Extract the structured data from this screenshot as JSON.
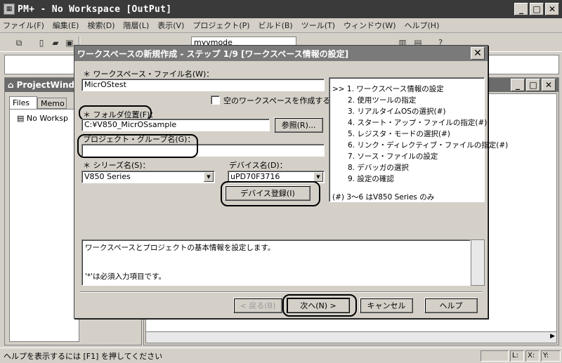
{
  "window": {
    "title": "PM+ - No Workspace [OutPut]"
  },
  "menu": [
    "ファイル(F)",
    "編集(E)",
    "検索(D)",
    "階層(L)",
    "表示(V)",
    "プロジェクト(P)",
    "ビルド(B)",
    "ツール(T)",
    "ウィンドウ(W)",
    "ヘルプ(H)"
  ],
  "toolbar": {
    "combo_value": "myvmode"
  },
  "project_window": {
    "title": "ProjectWindo",
    "tabs": [
      "Files",
      "Memo"
    ],
    "tree_item": "No Worksp"
  },
  "dialog": {
    "title": "ワークスペースの新規作成 - ステップ 1/9 [ワークスペース情報の設定]",
    "workspace_label": "＊ ワークスペース・ファイル名(W)：",
    "workspace_value": "MicrOStest",
    "empty_workspace_label": "空のワークスペースを作成する(E)",
    "folder_label": "＊ フォルダ位置(F)：",
    "folder_value": "C:¥V850_MicrOSsample",
    "browse_label": "参照(R)...",
    "group_label": "プロジェクト・グループ名(G)：",
    "group_value": "",
    "series_label": "＊ シリーズ名(S)：",
    "series_value": "V850 Series",
    "device_label": "デバイス名(D)：",
    "device_value": "uPD70F3716",
    "device_register_label": "デバイス登録(I)",
    "steps": [
      ">> 1. ワークスペース情報の設定",
      "2. 使用ツールの指定",
      "3. リアルタイムOSの選択(#)",
      "4. スタート・アップ・ファイルの指定(#)",
      "5. レジスタ・モードの選択(#)",
      "6. リンク・ディレクティブ・ファイルの指定(#)",
      "7. ソース・ファイルの設定",
      "8. デバッガの選択",
      "9. 設定の確認"
    ],
    "steps_note": "(#) 3～6 はV850 Series のみ",
    "description_line1": "ワークスペースとプロジェクトの基本情報を設定します。",
    "description_line2": "'*'は必須入力項目です。",
    "back_label": "< 戻る(B)",
    "next_label": "次へ(N) >",
    "cancel_label": "キャンセル",
    "help_label": "ヘルプ"
  },
  "status": {
    "message": "ヘルプを表示するには [F1] を押してください",
    "col": "L:",
    "x": "X:",
    "y": "Y:"
  }
}
